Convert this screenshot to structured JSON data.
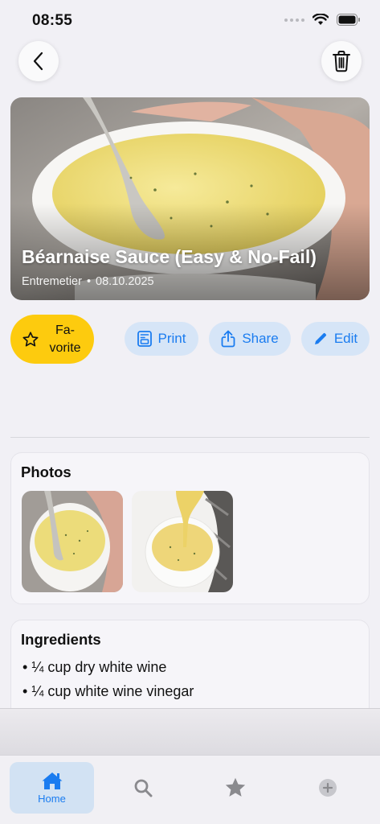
{
  "status_bar": {
    "time": "08:55"
  },
  "header": {
    "back_icon": "chevron-left-icon",
    "delete_icon": "trash-icon"
  },
  "recipe": {
    "title": "Béarnaise Sauce (Easy & No-Fail)",
    "category": "Entremetier",
    "separator": "•",
    "date": "08.10.2025"
  },
  "actions": {
    "favorite_label": "Fa-\nvorite",
    "print_label": "Print",
    "share_label": "Share",
    "edit_label": "Edit"
  },
  "photos": {
    "title": "Photos",
    "count": 2
  },
  "ingredients": {
    "title": "Ingredients",
    "items": [
      "¼ cup dry white wine",
      "¼ cup white wine vinegar"
    ]
  },
  "tab_bar": {
    "tabs": [
      {
        "label": "Home",
        "icon": "house-icon",
        "active": true
      },
      {
        "label": "",
        "icon": "search-icon",
        "active": false
      },
      {
        "label": "",
        "icon": "star-icon",
        "active": false
      },
      {
        "label": "",
        "icon": "plus-circle-icon",
        "active": false
      }
    ]
  },
  "colors": {
    "accent": "#1a7cf0",
    "favorite": "#fdcb0e",
    "background": "#f1f0f5"
  }
}
